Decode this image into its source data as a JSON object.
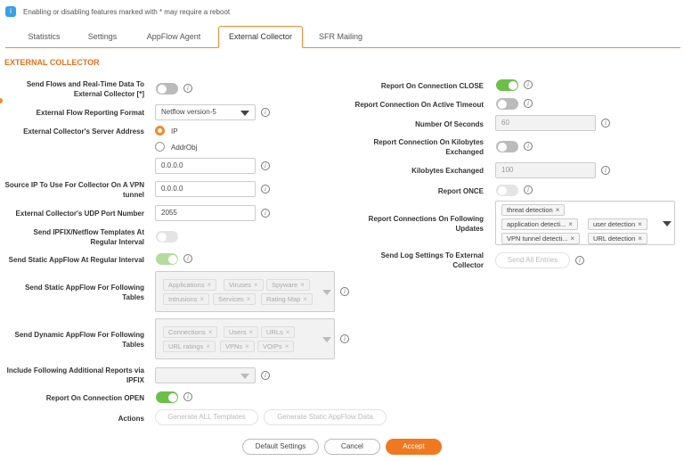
{
  "notice": "Enabling or disabling features marked with * may require a reboot",
  "tabs": [
    "Statistics",
    "Settings",
    "AppFlow Agent",
    "External Collector",
    "SFR Mailing"
  ],
  "section_title": "EXTERNAL COLLECTOR",
  "left": {
    "send_flows_l1": "Send Flows and Real-Time Data To",
    "send_flows_l2": "External Collector [*]",
    "format_label": "External Flow Reporting Format",
    "format_value": "Netflow version-5",
    "server_label": "External Collector's Server Address",
    "radio_ip": "IP",
    "radio_addrobj": "AddrObj",
    "server_value": "0.0.0.0",
    "source_ip_l1": "Source IP To Use For Collector On A VPN",
    "source_ip_l2": "tunnel",
    "source_ip_value": "0.0.0.0",
    "udp_label": "External Collector's UDP Port Number",
    "udp_value": "2055",
    "ipfix_l1": "Send IPFIX/Netflow Templates At",
    "ipfix_l2": "Regular Interval",
    "static_interval_label": "Send Static AppFlow At Regular Interval",
    "static_tables_l1": "Send Static AppFlow For Following",
    "static_tables_l2": "Tables",
    "static_chips": [
      "Applications",
      "Viruses",
      "Spyware",
      "Intrusions",
      "Services",
      "Rating Map"
    ],
    "dynamic_tables_l1": "Send Dynamic AppFlow For Following",
    "dynamic_tables_l2": "Tables",
    "dynamic_chips": [
      "Connections",
      "Users",
      "URLs",
      "URL ratings",
      "VPNs",
      "VOIPs"
    ],
    "additional_l1": "Include Following Additional Reports via",
    "additional_l2": "IPFIX",
    "open_label": "Report On Connection OPEN",
    "actions_label": "Actions",
    "gen_all": "Generate ALL Templates",
    "gen_static": "Generate Static AppFlow Data"
  },
  "right": {
    "close_label": "Report On Connection CLOSE",
    "active_timeout_label": "Report Connection On Active Timeout",
    "seconds_label": "Number Of Seconds",
    "seconds_value": "60",
    "kb_l1": "Report Connection On Kilobytes",
    "kb_l2": "Exchanged",
    "kb_label": "Kilobytes Exchanged",
    "kb_value": "100",
    "once_label": "Report ONCE",
    "following_l1": "Report Connections On Following",
    "following_l2": "Updates",
    "update_chips": [
      "threat detection",
      "application detecti...",
      "user detection",
      "VPN tunnel detecti...",
      "URL detection"
    ],
    "log_l1": "Send Log Settings To External",
    "log_l2": "Collector",
    "send_all": "Send All Entries"
  },
  "footer": {
    "default": "Default Settings",
    "cancel": "Cancel",
    "accept": "Accept"
  },
  "colors": {
    "accent": "#f07820",
    "toggle_on": "#6cc04a"
  }
}
